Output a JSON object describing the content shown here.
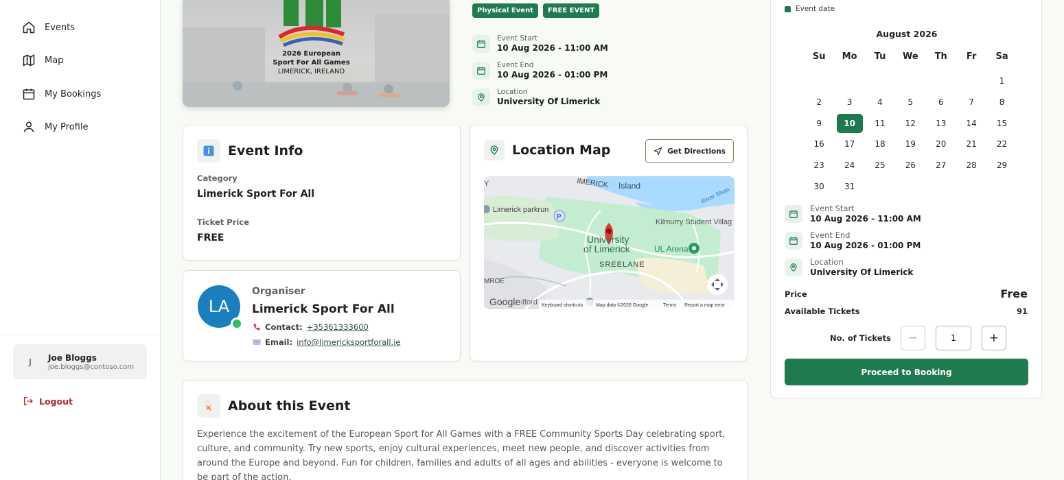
{
  "nav": {
    "items": [
      {
        "label": "Events",
        "icon": "home-icon"
      },
      {
        "label": "Map",
        "icon": "map-icon"
      },
      {
        "label": "My Bookings",
        "icon": "calendar-icon"
      },
      {
        "label": "My Profile",
        "icon": "user-icon"
      }
    ]
  },
  "user": {
    "initial": "J",
    "name": "Joe Bloggs",
    "email": "joe.bloggs@contoso.com"
  },
  "logout_label": "Logout",
  "hero": {
    "line1": "2026 European",
    "line2": "Sport For All Games",
    "line3": "LIMERICK, IRELAND"
  },
  "badges": [
    "Physical Event",
    "FREE EVENT"
  ],
  "event": {
    "start_label": "Event Start",
    "start_value": "10 Aug 2026 - 11:00 AM",
    "end_label": "Event End",
    "end_value": "10 Aug 2026 - 01:00 PM",
    "location_label": "Location",
    "location_value": "University Of Limerick"
  },
  "event_info": {
    "title": "Event Info",
    "category_label": "Category",
    "category_value": "Limerick Sport For All",
    "price_label": "Ticket Price",
    "price_value": "FREE"
  },
  "organiser": {
    "initials": "LA",
    "label": "Organiser",
    "name": "Limerick Sport For All",
    "contact_label": "Contact:",
    "contact_value": "+35361333600",
    "email_label": "Email:",
    "email_value": "info@limericksportforall.ie"
  },
  "location_map": {
    "title": "Location Map",
    "directions_label": "Get Directions",
    "labels": {
      "island": "Island",
      "limerick_word": "IMERICK",
      "river": "River Shan",
      "parkrun": "Limerick parkrun",
      "kilmurry": "Kilmurry Student Villag",
      "university": "University",
      "university2": "of Limerick",
      "ul_arena": "UL Arena",
      "sreelane": "SREELANE",
      "mroe": "MROE",
      "google": "Google",
      "milford": "ilford",
      "shortcuts": "Keyboard shortcuts",
      "mapdata": "Map data ©2026 Google",
      "terms": "Terms",
      "report": "Report a map error",
      "y": "Y",
      "parking": "P"
    }
  },
  "about": {
    "title": "About this Event",
    "text": "Experience the excitement of the European Sport for All Games with a FREE Community Sports Day celebrating sport, culture, and community. Try new sports, enjoy cultural experiences, meet new people, and discover activities from around the Europe and beyond. Fun for children, families and adults of all ages and abilities - everyone is welcome to be part of the action."
  },
  "calendar": {
    "legend": "Event date",
    "month": "August 2026",
    "weekdays": [
      "Su",
      "Mo",
      "Tu",
      "We",
      "Th",
      "Fr",
      "Sa"
    ],
    "leading_blanks": 6,
    "days": 31,
    "selected_day": 10
  },
  "booking": {
    "price_label": "Price",
    "price_value": "Free",
    "tickets_label": "Available Tickets",
    "tickets_value": "91",
    "qty_label": "No. of Tickets",
    "qty_value": "1",
    "minus": "−",
    "plus": "+",
    "proceed_label": "Proceed to Booking"
  },
  "colors": {
    "primary": "#1f7a4f",
    "danger": "#c0262d"
  }
}
